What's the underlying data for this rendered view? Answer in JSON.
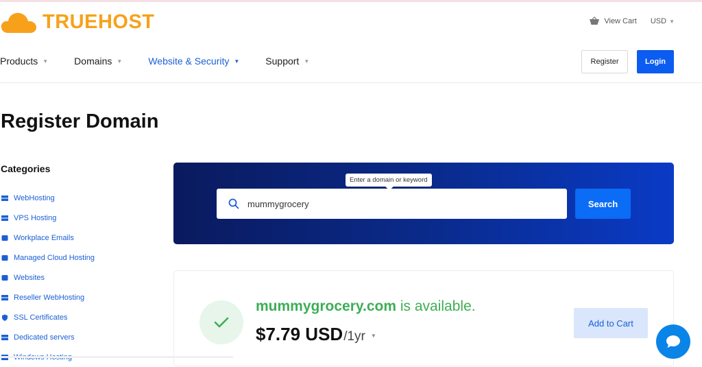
{
  "brand": {
    "name": "TRUEHOST",
    "color": "#f7a11a"
  },
  "header": {
    "view_cart": "View Cart",
    "currency": "USD",
    "register": "Register",
    "login": "Login"
  },
  "nav": [
    {
      "label": "Products",
      "active": false
    },
    {
      "label": "Domains",
      "active": false
    },
    {
      "label": "Website & Security",
      "active": true
    },
    {
      "label": "Support",
      "active": false
    }
  ],
  "page": {
    "title": "Register Domain"
  },
  "sidebar": {
    "title": "Categories",
    "items": [
      {
        "label": "WebHosting",
        "icon": "server-icon"
      },
      {
        "label": "VPS Hosting",
        "icon": "server-icon"
      },
      {
        "label": "Workplace Emails",
        "icon": "box-icon"
      },
      {
        "label": "Managed Cloud Hosting",
        "icon": "box-icon"
      },
      {
        "label": "Websites",
        "icon": "box-icon"
      },
      {
        "label": "Reseller WebHosting",
        "icon": "server-icon"
      },
      {
        "label": "SSL Certificates",
        "icon": "shield-icon"
      },
      {
        "label": "Dedicated servers",
        "icon": "server-icon"
      },
      {
        "label": "Windows Hosting",
        "icon": "server-icon"
      }
    ]
  },
  "search": {
    "tooltip": "Enter a domain or keyword",
    "value": "mummygrocery",
    "button": "Search"
  },
  "result": {
    "domain": "mummygrocery.com",
    "status": " is available.",
    "price": "$7.79 USD",
    "period": "/1yr",
    "add_to_cart": "Add to Cart"
  },
  "colors": {
    "primary": "#0b5cf0",
    "available": "#3cae55",
    "panel": "#0a2a8a"
  }
}
